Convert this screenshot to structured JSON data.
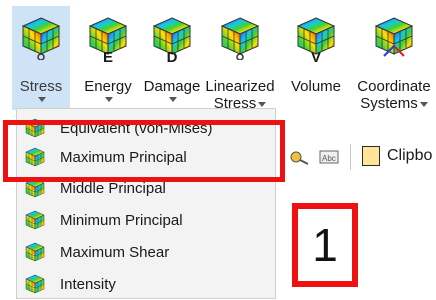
{
  "ribbon": {
    "buttons": [
      {
        "id": "stress",
        "label": "Stress",
        "letter": "",
        "has_caret": true
      },
      {
        "id": "energy",
        "label": "Energy",
        "letter": "E",
        "has_caret": true
      },
      {
        "id": "damage",
        "label": "Damage",
        "letter": "D",
        "has_caret": true
      },
      {
        "id": "linearized",
        "label1": "Linearized",
        "label2": "Stress",
        "letter": "",
        "has_caret": true
      },
      {
        "id": "volume",
        "label": "Volume",
        "letter": "V",
        "has_caret": false
      },
      {
        "id": "coord",
        "label1": "Coordinate",
        "label2": "Systems",
        "letter": "",
        "has_caret": true
      }
    ]
  },
  "toolbar": {
    "clipboard_label": "Clipbo"
  },
  "menu": {
    "items": [
      {
        "label": "Equivalent (von-Mises)"
      },
      {
        "label": "Maximum Principal"
      },
      {
        "label": "Middle Principal"
      },
      {
        "label": "Minimum Principal"
      },
      {
        "label": "Maximum Shear"
      },
      {
        "label": "Intensity"
      }
    ]
  },
  "annotation": {
    "step_number": "1",
    "highlight_color": "#ee1111"
  },
  "colors": {
    "selected_button_bg": "#cfe3f6",
    "menu_bg": "#f3f3f3"
  }
}
